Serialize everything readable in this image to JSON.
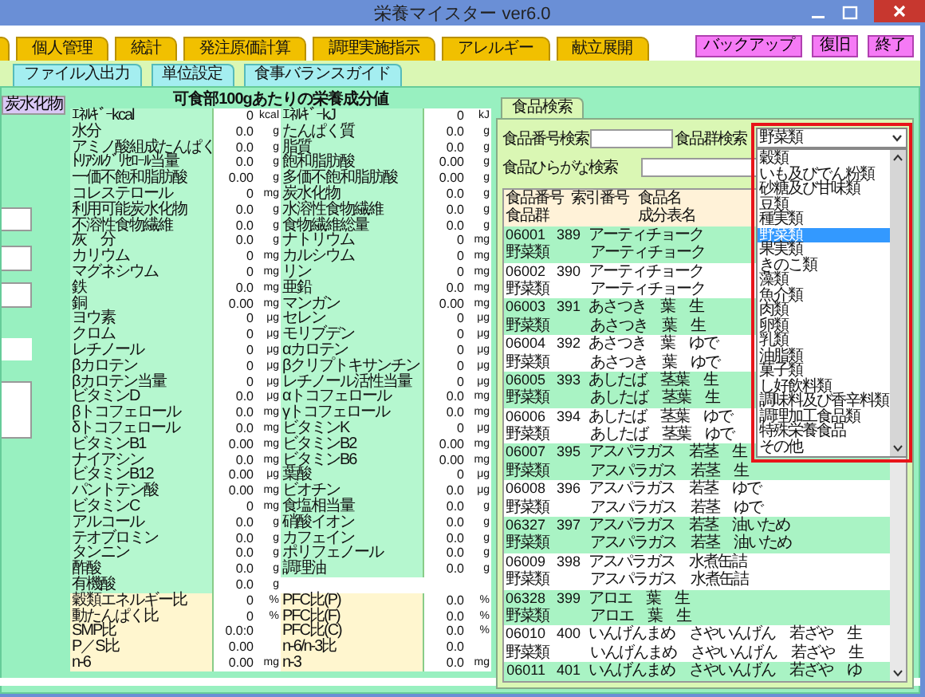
{
  "window": {
    "title": "栄養マイスター ver6.0"
  },
  "tabs": [
    {
      "label": "個人管理",
      "selected": false
    },
    {
      "label": "統計",
      "selected": false
    },
    {
      "label": "発注原価計算",
      "selected": false
    },
    {
      "label": "調理実施指示",
      "selected": false
    },
    {
      "label": "アレルギー",
      "selected": false
    },
    {
      "label": "献立展開",
      "selected": false
    }
  ],
  "buttons": [
    "バックアップ",
    "復旧",
    "終了"
  ],
  "subtabs": [
    {
      "label": "ファイル入出力",
      "selected": false
    },
    {
      "label": "単位設定",
      "selected": false
    },
    {
      "label": "食事バランスガイド",
      "selected": false
    }
  ],
  "left_panel": {
    "button": "炭水化物"
  },
  "nutrients": {
    "title": "可食部100gあたりの栄養成分値",
    "rows": [
      {
        "kind": "nutrient",
        "cells": [
          {
            "name": "ｴﾈﾙｷﾞｰkcal",
            "value": "0",
            "unit": "kcal"
          },
          {
            "name": "ｴﾈﾙｷﾞｰkJ",
            "value": "0",
            "unit": "kJ"
          }
        ]
      },
      {
        "kind": "nutrient",
        "cells": [
          {
            "name": "水分",
            "value": "0.0",
            "unit": "g"
          },
          {
            "name": "たんぱく質",
            "value": "0.0",
            "unit": "g"
          }
        ]
      },
      {
        "kind": "nutrient",
        "cells": [
          {
            "name": "アミノ酸組成たんぱく",
            "value": "0.0",
            "unit": "g"
          },
          {
            "name": "脂質",
            "value": "0.0",
            "unit": "g"
          }
        ]
      },
      {
        "kind": "nutrient",
        "cells": [
          {
            "name": "ﾄﾘｱｼﾙｸﾞﾘｾﾛｰﾙ当量",
            "value": "0.0",
            "unit": "g"
          },
          {
            "name": "飽和脂肪酸",
            "value": "0.00",
            "unit": "g"
          }
        ]
      },
      {
        "kind": "nutrient",
        "cells": [
          {
            "name": "一価不飽和脂肪酸",
            "value": "0.00",
            "unit": "g"
          },
          {
            "name": "多価不飽和脂肪酸",
            "value": "0.00",
            "unit": "g"
          }
        ]
      },
      {
        "kind": "nutrient",
        "cells": [
          {
            "name": "コレステロール",
            "value": "0",
            "unit": "mg"
          },
          {
            "name": "炭水化物",
            "value": "0.0",
            "unit": "g"
          }
        ]
      },
      {
        "kind": "nutrient",
        "cells": [
          {
            "name": "利用可能炭水化物",
            "value": "0.0",
            "unit": "g"
          },
          {
            "name": "水溶性食物繊維",
            "value": "0.0",
            "unit": "g"
          }
        ]
      },
      {
        "kind": "nutrient",
        "cells": [
          {
            "name": "不溶性食物繊維",
            "value": "0.0",
            "unit": "g"
          },
          {
            "name": "食物繊維総量",
            "value": "0.0",
            "unit": "g"
          }
        ]
      },
      {
        "kind": "nutrient",
        "cells": [
          {
            "name": "灰　分",
            "value": "0.0",
            "unit": "g"
          },
          {
            "name": "ナトリウム",
            "value": "0",
            "unit": "mg"
          }
        ]
      },
      {
        "kind": "nutrient",
        "cells": [
          {
            "name": "カリウム",
            "value": "0",
            "unit": "mg"
          },
          {
            "name": "カルシウム",
            "value": "0",
            "unit": "mg"
          }
        ]
      },
      {
        "kind": "nutrient",
        "cells": [
          {
            "name": "マグネシウム",
            "value": "0",
            "unit": "mg"
          },
          {
            "name": "リン",
            "value": "0",
            "unit": "mg"
          }
        ]
      },
      {
        "kind": "nutrient",
        "cells": [
          {
            "name": "鉄",
            "value": "0.0",
            "unit": "mg"
          },
          {
            "name": "亜鉛",
            "value": "0.0",
            "unit": "mg"
          }
        ]
      },
      {
        "kind": "nutrient",
        "cells": [
          {
            "name": "銅",
            "value": "0.00",
            "unit": "mg"
          },
          {
            "name": "マンガン",
            "value": "0.00",
            "unit": "mg"
          }
        ]
      },
      {
        "kind": "nutrient",
        "cells": [
          {
            "name": "ヨウ素",
            "value": "0",
            "unit": "μg"
          },
          {
            "name": "セレン",
            "value": "0",
            "unit": "μg"
          }
        ]
      },
      {
        "kind": "nutrient",
        "cells": [
          {
            "name": "クロム",
            "value": "0",
            "unit": "μg"
          },
          {
            "name": "モリブデン",
            "value": "0",
            "unit": "μg"
          }
        ]
      },
      {
        "kind": "nutrient",
        "cells": [
          {
            "name": "レチノール",
            "value": "0",
            "unit": "μg"
          },
          {
            "name": "αカロテン",
            "value": "0",
            "unit": "μg"
          }
        ]
      },
      {
        "kind": "nutrient",
        "cells": [
          {
            "name": "βカロテン",
            "value": "0",
            "unit": "μg"
          },
          {
            "name": "βクリプトキサンチン",
            "value": "0",
            "unit": "μg"
          }
        ]
      },
      {
        "kind": "nutrient",
        "cells": [
          {
            "name": "βカロテン当量",
            "value": "0",
            "unit": "μg"
          },
          {
            "name": "レチノール活性当量",
            "value": "0",
            "unit": "μg"
          }
        ]
      },
      {
        "kind": "nutrient",
        "cells": [
          {
            "name": "ビタミンD",
            "value": "0.0",
            "unit": "μg"
          },
          {
            "name": "αトコフェロール",
            "value": "0.0",
            "unit": "mg"
          }
        ]
      },
      {
        "kind": "nutrient",
        "cells": [
          {
            "name": "βトコフェロール",
            "value": "0.0",
            "unit": "mg"
          },
          {
            "name": "γトコフェロール",
            "value": "0.0",
            "unit": "mg"
          }
        ]
      },
      {
        "kind": "nutrient",
        "cells": [
          {
            "name": "δトコフェロール",
            "value": "0.0",
            "unit": "mg"
          },
          {
            "name": "ビタミンK",
            "value": "0",
            "unit": "μg"
          }
        ]
      },
      {
        "kind": "nutrient",
        "cells": [
          {
            "name": "ビタミンB1",
            "value": "0.00",
            "unit": "mg"
          },
          {
            "name": "ビタミンB2",
            "value": "0.00",
            "unit": "mg"
          }
        ]
      },
      {
        "kind": "nutrient",
        "cells": [
          {
            "name": "ナイアシン",
            "value": "0.0",
            "unit": "mg"
          },
          {
            "name": "ビタミンB6",
            "value": "0.00",
            "unit": "mg"
          }
        ]
      },
      {
        "kind": "nutrient",
        "cells": [
          {
            "name": "ビタミンB12",
            "value": "0.00",
            "unit": "μg"
          },
          {
            "name": "葉酸",
            "value": "0",
            "unit": "μg"
          }
        ]
      },
      {
        "kind": "nutrient",
        "cells": [
          {
            "name": "パントテン酸",
            "value": "0.00",
            "unit": "mg"
          },
          {
            "name": "ビオチン",
            "value": "0.0",
            "unit": "μg"
          }
        ]
      },
      {
        "kind": "nutrient",
        "cells": [
          {
            "name": "ビタミンC",
            "value": "0",
            "unit": "mg"
          },
          {
            "name": "食塩相当量",
            "value": "0.0",
            "unit": "g"
          }
        ]
      },
      {
        "kind": "nutrient",
        "cells": [
          {
            "name": "アルコール",
            "value": "0.0",
            "unit": "g"
          },
          {
            "name": "硝酸イオン",
            "value": "0.0",
            "unit": "g"
          }
        ]
      },
      {
        "kind": "nutrient",
        "cells": [
          {
            "name": "テオブロミン",
            "value": "0.0",
            "unit": "g"
          },
          {
            "name": "カフェイン",
            "value": "0.0",
            "unit": "g"
          }
        ]
      },
      {
        "kind": "nutrient",
        "cells": [
          {
            "name": "タンニン",
            "value": "0.0",
            "unit": "g"
          },
          {
            "name": "ポリフェノール",
            "value": "0.0",
            "unit": "g"
          }
        ]
      },
      {
        "kind": "nutrient",
        "cells": [
          {
            "name": "酢酸",
            "value": "0.0",
            "unit": "g"
          },
          {
            "name": "調理油",
            "value": "0.0",
            "unit": "g"
          }
        ]
      },
      {
        "kind": "nutrient",
        "cells": [
          {
            "name": "有機酸",
            "value": "0.0",
            "unit": "g"
          }
        ]
      },
      {
        "kind": "ratio",
        "cells": [
          {
            "name": "穀類エネルギー比",
            "value": "0",
            "unit": "%"
          },
          {
            "name": "PFC比(P)",
            "value": "0.0",
            "unit": "%"
          }
        ]
      },
      {
        "kind": "ratio",
        "cells": [
          {
            "name": "動たんぱく比",
            "value": "0",
            "unit": "%"
          },
          {
            "name": "PFC比(F)",
            "value": "0.0",
            "unit": "%"
          }
        ]
      },
      {
        "kind": "ratio",
        "cells": [
          {
            "name": "SMP比",
            "value": "0.0:0"
          },
          {
            "name": "PFC比(C)",
            "value": "0.0",
            "unit": "%"
          }
        ]
      },
      {
        "kind": "ratio",
        "cells": [
          {
            "name": "P／S比",
            "value": "0.00"
          },
          {
            "name": "n-6/n-3比",
            "value": "0.0"
          }
        ]
      },
      {
        "kind": "ratio",
        "cells": [
          {
            "name": "n-6",
            "value": "0.00",
            "unit": "mg"
          },
          {
            "name": "n-3",
            "value": "0.0",
            "unit": "mg"
          }
        ]
      }
    ]
  },
  "food_search": {
    "tab": "食品検索",
    "number_label": "食品番号検索",
    "group_label": "食品群検索",
    "group_value": "野菜類",
    "hiragana_label": "食品ひらがな検索",
    "group_options": [
      {
        "label": "穀類",
        "selected": false
      },
      {
        "label": "いも及びでん粉類",
        "selected": false
      },
      {
        "label": "砂糖及び甘味類",
        "selected": false
      },
      {
        "label": "豆類",
        "selected": false
      },
      {
        "label": "種実類",
        "selected": false
      },
      {
        "label": "野菜類",
        "selected": true
      },
      {
        "label": "果実類",
        "selected": false
      },
      {
        "label": "きのこ類",
        "selected": false
      },
      {
        "label": "藻類",
        "selected": false
      },
      {
        "label": "魚介類",
        "selected": false
      },
      {
        "label": "肉類",
        "selected": false
      },
      {
        "label": "卵類",
        "selected": false
      },
      {
        "label": "乳類",
        "selected": false
      },
      {
        "label": "油脂類",
        "selected": false
      },
      {
        "label": "菓子類",
        "selected": false
      },
      {
        "label": "し好飲料類",
        "selected": false
      },
      {
        "label": "調味料及び香辛料類",
        "selected": false
      },
      {
        "label": "調理加工食品類",
        "selected": false
      },
      {
        "label": "特殊栄養食品",
        "selected": false
      },
      {
        "label": "その他",
        "selected": false
      }
    ],
    "columns": {
      "number": "食品番号",
      "index": "索引番号",
      "name": "食品名",
      "group": "食品群",
      "table_name": "成分表名"
    },
    "rows": [
      {
        "number": "06001",
        "index": "389",
        "name": "アーティチョーク",
        "group": "野菜類",
        "table_name": "アーティチョーク"
      },
      {
        "number": "06002",
        "index": "390",
        "name": "アーティチョーク",
        "group": "野菜類",
        "table_name": "アーティチョーク"
      },
      {
        "number": "06003",
        "index": "391",
        "name": "あさつき　葉　生",
        "group": "野菜類",
        "table_name": "あさつき　葉　生"
      },
      {
        "number": "06004",
        "index": "392",
        "name": "あさつき　葉　ゆで",
        "group": "野菜類",
        "table_name": "あさつき　葉　ゆで"
      },
      {
        "number": "06005",
        "index": "393",
        "name": "あしたば　茎葉　生",
        "group": "野菜類",
        "table_name": "あしたば　茎葉　生"
      },
      {
        "number": "06006",
        "index": "394",
        "name": "あしたば　茎葉　ゆで",
        "group": "野菜類",
        "table_name": "あしたば　茎葉　ゆで"
      },
      {
        "number": "06007",
        "index": "395",
        "name": "アスパラガス　若茎　生",
        "group": "野菜類",
        "table_name": "アスパラガス　若茎　生"
      },
      {
        "number": "06008",
        "index": "396",
        "name": "アスパラガス　若茎　ゆで",
        "group": "野菜類",
        "table_name": "アスパラガス　若茎　ゆで"
      },
      {
        "number": "06327",
        "index": "397",
        "name": "アスパラガス　若茎　油いため",
        "group": "野菜類",
        "table_name": "アスパラガス　若茎　油いため"
      },
      {
        "number": "06009",
        "index": "398",
        "name": "アスパラガス　水煮缶詰",
        "group": "野菜類",
        "table_name": "アスパラガス　水煮缶詰"
      },
      {
        "number": "06328",
        "index": "399",
        "name": "アロエ　葉　生",
        "group": "野菜類",
        "table_name": "アロエ　葉　生"
      },
      {
        "number": "06010",
        "index": "400",
        "name": "いんげんまめ　さやいんげん　若ざや　生",
        "group": "野菜類",
        "table_name": "いんげんまめ　さやいんげん　若ざや　生"
      },
      {
        "number": "06011",
        "index": "401",
        "name": "いんげんまめ　さやいんげん　若ざや　ゆ"
      }
    ]
  }
}
